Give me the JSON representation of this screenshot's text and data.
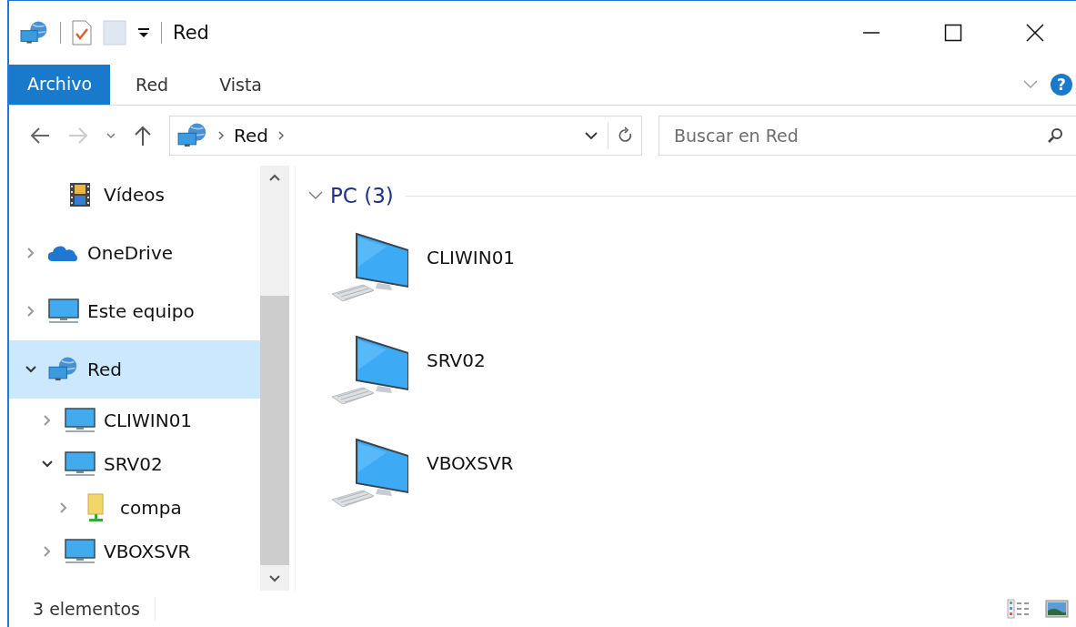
{
  "window": {
    "title": "Red"
  },
  "ribbon": {
    "tabs": [
      {
        "label": "Archivo",
        "selected": true,
        "kind": "file"
      },
      {
        "label": "Red",
        "selected": false,
        "kind": "tab"
      },
      {
        "label": "Vista",
        "selected": false,
        "kind": "tab"
      }
    ],
    "help": "?"
  },
  "address_bar": {
    "crumbs": [
      "Red"
    ],
    "search": {
      "placeholder": "Buscar en Red"
    }
  },
  "nav_tree": [
    {
      "children": [
        {
          "label": "Vídeos",
          "kind": "film",
          "selected": false
        }
      ]
    },
    {
      "label": "OneDrive",
      "kind": "cloud",
      "expanded": false,
      "selected": false
    },
    {
      "label": "Este equipo",
      "kind": "monitor",
      "expanded": false,
      "selected": false
    },
    {
      "label": "Red",
      "kind": "network",
      "expanded": true,
      "selected": true,
      "children": [
        {
          "label": "CLIWIN01",
          "kind": "monitor",
          "expanded": false,
          "selected": false
        },
        {
          "label": "SRV02",
          "kind": "monitor",
          "expanded": true,
          "selected": false,
          "children": [
            {
              "label": "compa",
              "kind": "share",
              "expanded": false,
              "selected": false
            }
          ]
        },
        {
          "label": "VBOXSVR",
          "kind": "monitor",
          "expanded": false,
          "selected": false
        }
      ]
    }
  ],
  "group": {
    "title": "PC (3)",
    "expanded": true,
    "items": [
      {
        "label": "CLIWIN01"
      },
      {
        "label": "SRV02"
      },
      {
        "label": "VBOXSVR"
      }
    ]
  },
  "status_bar": {
    "text": "3 elementos"
  }
}
